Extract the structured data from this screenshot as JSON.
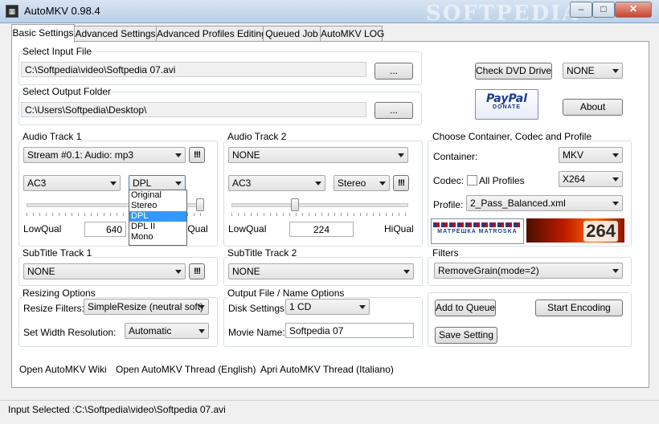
{
  "window": {
    "title": "AutoMKV 0.98.4",
    "watermark": "SOFTPEDIA",
    "app_icon": "film-icon"
  },
  "tabs": [
    {
      "label": "Basic Settings",
      "active": true
    },
    {
      "label": "Advanced Settings",
      "active": false
    },
    {
      "label": "Advanced Profiles Editing",
      "active": false
    },
    {
      "label": "Queued Job",
      "active": false
    },
    {
      "label": "AutoMKV LOG",
      "active": false
    }
  ],
  "input_file": {
    "label": "Select Input File",
    "value": "C:\\Softpedia\\video\\Softpedia 07.avi",
    "browse_label": "..."
  },
  "output_folder": {
    "label": "Select Output Folder",
    "value": "C:\\Users\\Softpedia\\Desktop\\",
    "browse_label": "..."
  },
  "dvd": {
    "check_label": "Check DVD Drive",
    "drive_value": "NONE"
  },
  "paypal": {
    "logo_text": "PayPal",
    "sub_text": "DONATE"
  },
  "about_label": "About",
  "audio_track_1": {
    "label": "Audio Track 1",
    "stream": "Stream #0.1: Audio: mp3",
    "codec": "AC3",
    "channel_mode": "DPL",
    "low_label": "LowQual",
    "high_label": "HiQual",
    "bitrate": "640",
    "quality_fraction": 1.0,
    "dropdown_options": [
      {
        "label": "Original",
        "selected": false
      },
      {
        "label": "Stereo",
        "selected": false
      },
      {
        "label": "DPL",
        "selected": true
      },
      {
        "label": "DPL II",
        "selected": false
      },
      {
        "label": "Mono",
        "selected": false
      }
    ],
    "info_label": "!!!"
  },
  "audio_track_2": {
    "label": "Audio Track 2",
    "stream": "NONE",
    "codec": "AC3",
    "channel_mode": "Stereo",
    "low_label": "LowQual",
    "high_label": "HiQual",
    "bitrate": "224",
    "quality_fraction": 0.35,
    "info_label": "!!!"
  },
  "container_group": {
    "label": "Choose Container, Codec and Profile",
    "container_label": "Container:",
    "container_value": "MKV",
    "codec_label": "Codec:",
    "all_profiles_label": "All Profiles",
    "codec_value": "X264",
    "profile_label": "Profile:",
    "profile_value": "2_Pass_Balanced.xml",
    "matroska_logo": "МАТРЁШКА MATROSKA",
    "x264_logo": "264"
  },
  "subtitle_1": {
    "label": "SubTitle Track 1",
    "value": "NONE",
    "info_label": "!!!"
  },
  "subtitle_2": {
    "label": "SubTitle Track 2",
    "value": "NONE"
  },
  "filters": {
    "label": "Filters",
    "value": "RemoveGrain(mode=2)"
  },
  "resizing": {
    "label": "Resizing Options",
    "filters_label": "Resize Filters:",
    "filters_value": "SimpleResize (neutral soft)",
    "width_label": "Set Width Resolution:",
    "width_value": "Automatic"
  },
  "output_options": {
    "label": "Output File / Name Options",
    "disk_label": "Disk Settings:",
    "disk_value": "1 CD",
    "movie_label": "Movie Name:",
    "movie_value": "Softpedia 07"
  },
  "actions": {
    "add_queue": "Add to Queue",
    "start_encoding": "Start Encoding",
    "save_setting": "Save Setting"
  },
  "links": {
    "wiki": "Open AutoMKV Wiki",
    "thread_en": "Open AutoMKV Thread (English)",
    "thread_it": "Apri AutoMKV Thread (Italiano)"
  },
  "status": {
    "text": "Input Selected :C:\\Softpedia\\video\\Softpedia 07.avi"
  }
}
